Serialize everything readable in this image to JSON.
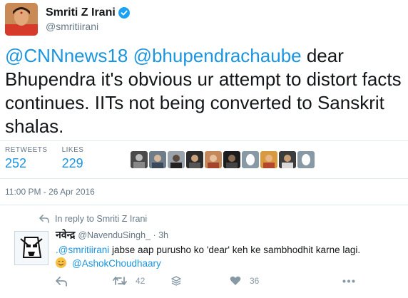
{
  "tweet": {
    "author_name": "Smriti Z Irani",
    "author_handle": "@smritiirani",
    "mention1": "@CNNnews18",
    "mention2": "@bhupendrachaube",
    "body": " dear Bhupendra it's obvious ur attempt to distort facts continues. IITs not being converted to Sanskrit shalas.",
    "retweets_label": "RETWEETS",
    "retweets_count": "252",
    "likes_label": "LIKES",
    "likes_count": "229",
    "timestamp": "11:00 PM - 26 Apr 2016",
    "liker_count": 10
  },
  "reply": {
    "context": "In reply to Smriti Z Irani",
    "author_name": "नवेन्द्र",
    "author_handle": "@NavenduSingh_ · 3h",
    "mention": ".@smritiirani",
    "body": " jabse aap purusho ko 'dear' keh ke sambhodhit karne lagi.",
    "mention2": "@AshokChoudhaary",
    "retweet_count": "42",
    "like_count": "36"
  },
  "colors": {
    "link": "#1b95e0",
    "muted": "#657786",
    "verified": "#1da1f2"
  },
  "icons": [
    "verified-badge-icon",
    "reply-arrow-icon",
    "retweet-icon",
    "stack-icon",
    "heart-icon",
    "more-icon",
    "smiley-emoji-icon"
  ]
}
